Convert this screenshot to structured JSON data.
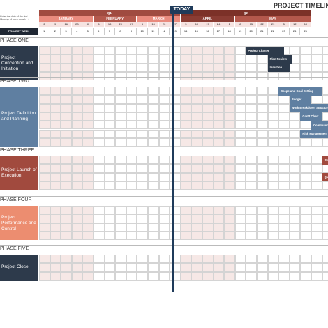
{
  "title": "PROJECT TIMELINE",
  "hint": "Enter the date of the first Monday of each month -->",
  "project_week_label": "PROJECT WEEK",
  "today_label": "TODAY",
  "quarters": [
    {
      "label": "Q1",
      "start": 0,
      "span": 13
    },
    {
      "label": "Q2",
      "start": 13,
      "span": 12
    }
  ],
  "months": [
    {
      "label": "JANUARY",
      "start": 0,
      "span": 5,
      "color": "#e98b7e"
    },
    {
      "label": "FEBRUARY",
      "start": 5,
      "span": 4,
      "color": "#b4584c"
    },
    {
      "label": "MARCH",
      "start": 9,
      "span": 4,
      "color": "#e98b7e"
    },
    {
      "label": "APRIL",
      "start": 13,
      "span": 5,
      "color": "#8a3c33"
    },
    {
      "label": "MAY",
      "start": 18,
      "span": 7,
      "color": "#b4584c"
    }
  ],
  "dates": [
    "2",
    "9",
    "16",
    "23",
    "30",
    "6",
    "13",
    "20",
    "27",
    "6",
    "13",
    "20",
    "27",
    "3",
    "10",
    "17",
    "24",
    "1",
    "8",
    "15",
    "22",
    "29",
    "5",
    "12",
    "19"
  ],
  "weeks": [
    "1",
    "2",
    "3",
    "4",
    "5",
    "6",
    "7",
    "8",
    "9",
    "10",
    "11",
    "12",
    "13",
    "14",
    "15",
    "16",
    "17",
    "18",
    "19",
    "20",
    "21",
    "22",
    "23",
    "24",
    "25"
  ],
  "phases": [
    {
      "title": "PHASE ONE",
      "name": "Project Conception and Initiation",
      "color": "#2d3a4b",
      "tasks": [
        {
          "label": "Project Charter",
          "col": 19,
          "row": 0,
          "w": 3.5,
          "color": "#2d3a4b"
        },
        {
          "label": "Plan Review",
          "col": 21,
          "row": 1,
          "w": 2.2,
          "color": "#2d3a4b"
        },
        {
          "label": "Initiation",
          "col": 21,
          "row": 2,
          "w": 2,
          "color": "#2d3a4b"
        }
      ]
    },
    {
      "title": "PHASE TWO",
      "name": "Project Definition and Planning",
      "color": "#5f7fa1",
      "tasks": [
        {
          "label": "Scope and Goal Setting",
          "col": 22,
          "row": 0,
          "w": 4,
          "color": "#5f7fa1"
        },
        {
          "label": "Budget",
          "col": 23,
          "row": 1,
          "w": 2,
          "color": "#5f7fa1"
        },
        {
          "label": "Work Breakdown Structure",
          "col": 23,
          "row": 2,
          "w": 3.6,
          "color": "#5f7fa1"
        },
        {
          "label": "Gantt Chart",
          "col": 24,
          "row": 3,
          "w": 2,
          "color": "#5f7fa1"
        },
        {
          "label": "Communication Plan",
          "col": 25,
          "row": 4,
          "w": 3,
          "color": "#5f7fa1"
        },
        {
          "label": "Risk Management",
          "col": 24,
          "row": 5,
          "w": 3,
          "color": "#5f7fa1"
        }
      ]
    },
    {
      "title": "PHASE THREE",
      "name": "Project Launch of Execution",
      "color": "#a14a3e",
      "tasks": [
        {
          "label": "Status",
          "col": 26,
          "row": 0,
          "w": 1.5,
          "color": "#a14a3e"
        },
        {
          "label": "Quality",
          "col": 26,
          "row": 2,
          "w": 1.5,
          "color": "#a14a3e"
        }
      ]
    },
    {
      "title": "PHASE FOUR",
      "name": "Project Performance and Control",
      "color": "#ec8d70",
      "tasks": []
    },
    {
      "title": "PHASE FIVE",
      "name": "Project Close",
      "color": "#2d3a4b",
      "tasks": []
    }
  ]
}
